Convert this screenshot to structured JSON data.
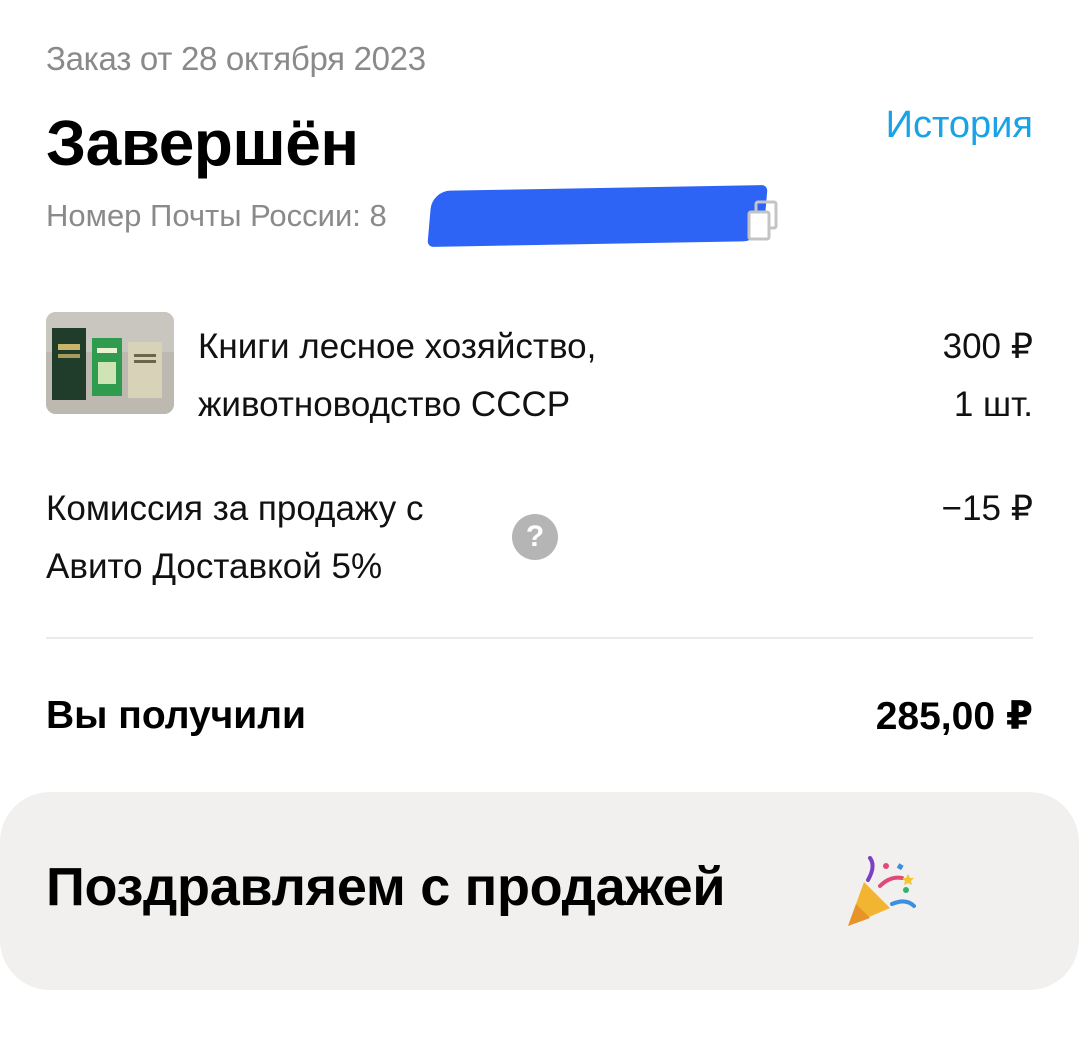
{
  "order": {
    "date_text": "Заказ от 28 октября 2023",
    "status": "Завершён",
    "history_link": "История",
    "tracking_label": "Номер Почты России: 8"
  },
  "item": {
    "title": "Книги лесное хозяйство, животноводство СССР",
    "price": "300 ₽",
    "quantity": "1 шт."
  },
  "fee": {
    "label": "Комиссия за продажу с Авито Доставкой 5%",
    "value": "−15 ₽",
    "help_icon": "question-circle-icon"
  },
  "total": {
    "label": "Вы получили",
    "value": "285,00 ₽"
  },
  "congrats": {
    "text": "Поздравляем с продажей",
    "icon": "party-popper-icon"
  },
  "colors": {
    "accent_link": "#19a3e6",
    "muted_text": "#8a8a8a",
    "card_bg": "#f1f0ee",
    "redaction": "#2d64f5"
  }
}
